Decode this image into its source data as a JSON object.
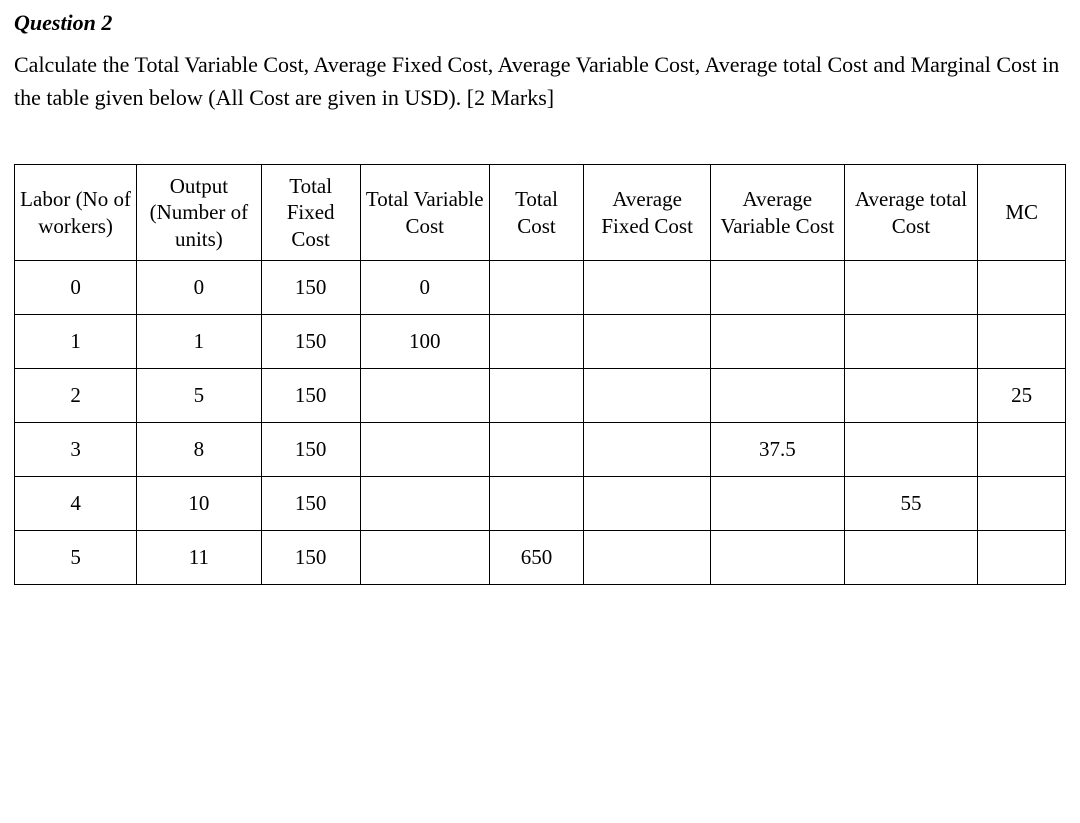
{
  "title": "Question 2",
  "prompt": "Calculate the Total Variable Cost, Average Fixed Cost, Average Variable Cost, Average total Cost and Marginal Cost in the table given below (All Cost are given in USD). [2 Marks]",
  "headers": {
    "labor": "Labor (No of workers)",
    "output": "Output (Number of units)",
    "tfc": "Total Fixed Cost",
    "tvc": "Total Variable Cost",
    "tc": "Total Cost",
    "afc": "Average Fixed Cost",
    "avc": "Average Variable Cost",
    "atc": "Average total Cost",
    "mc": "MC"
  },
  "chart_data": {
    "type": "table",
    "columns": [
      "Labor (No of workers)",
      "Output (Number of units)",
      "Total Fixed Cost",
      "Total Variable Cost",
      "Total Cost",
      "Average Fixed Cost",
      "Average Variable Cost",
      "Average total Cost",
      "MC"
    ],
    "rows": [
      {
        "labor": "0",
        "output": "0",
        "tfc": "150",
        "tvc": "0",
        "tc": "",
        "afc": "",
        "avc": "",
        "atc": "",
        "mc": ""
      },
      {
        "labor": "1",
        "output": "1",
        "tfc": "150",
        "tvc": "100",
        "tc": "",
        "afc": "",
        "avc": "",
        "atc": "",
        "mc": ""
      },
      {
        "labor": "2",
        "output": "5",
        "tfc": "150",
        "tvc": "",
        "tc": "",
        "afc": "",
        "avc": "",
        "atc": "",
        "mc": "25"
      },
      {
        "labor": "3",
        "output": "8",
        "tfc": "150",
        "tvc": "",
        "tc": "",
        "afc": "",
        "avc": "37.5",
        "atc": "",
        "mc": ""
      },
      {
        "labor": "4",
        "output": "10",
        "tfc": "150",
        "tvc": "",
        "tc": "",
        "afc": "",
        "avc": "",
        "atc": "55",
        "mc": ""
      },
      {
        "labor": "5",
        "output": "11",
        "tfc": "150",
        "tvc": "",
        "tc": "650",
        "afc": "",
        "avc": "",
        "atc": "",
        "mc": ""
      }
    ]
  }
}
